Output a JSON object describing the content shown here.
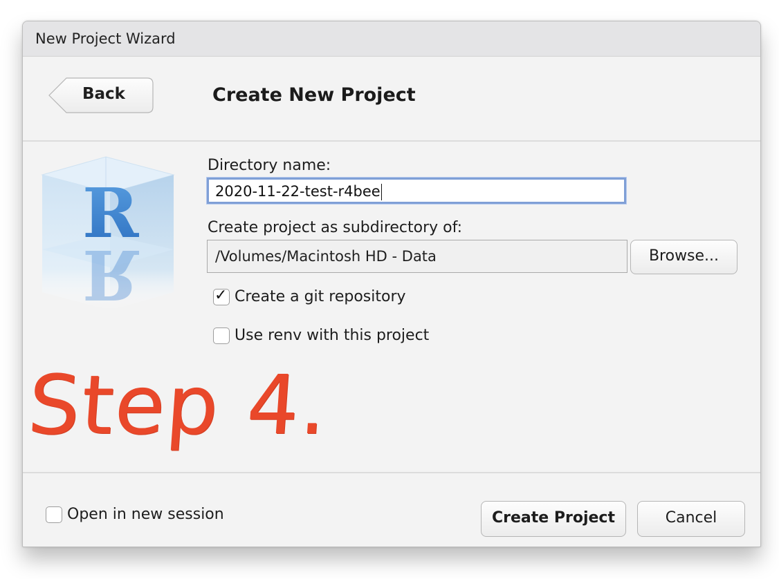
{
  "window": {
    "title": "New Project Wizard"
  },
  "header": {
    "back_label": "Back",
    "page_title": "Create New Project"
  },
  "form": {
    "directory_label": "Directory name:",
    "directory_value": "2020-11-22-test-r4bee",
    "subdir_label": "Create project as subdirectory of:",
    "subdir_value": "/Volumes/Macintosh HD - Data",
    "browse_label": "Browse...",
    "git_label": "Create a git repository",
    "git_checked": true,
    "renv_label": "Use renv with this project",
    "renv_checked": false
  },
  "annotation": {
    "text": "Step 4."
  },
  "footer": {
    "new_session_label": "Open in new session",
    "new_session_checked": false,
    "create_label": "Create Project",
    "cancel_label": "Cancel"
  },
  "colors": {
    "annotation": "#e9482a",
    "focus_border": "#7f9fd6",
    "r_logo": "#3b7fd0"
  },
  "logo": {
    "letter": "R"
  }
}
